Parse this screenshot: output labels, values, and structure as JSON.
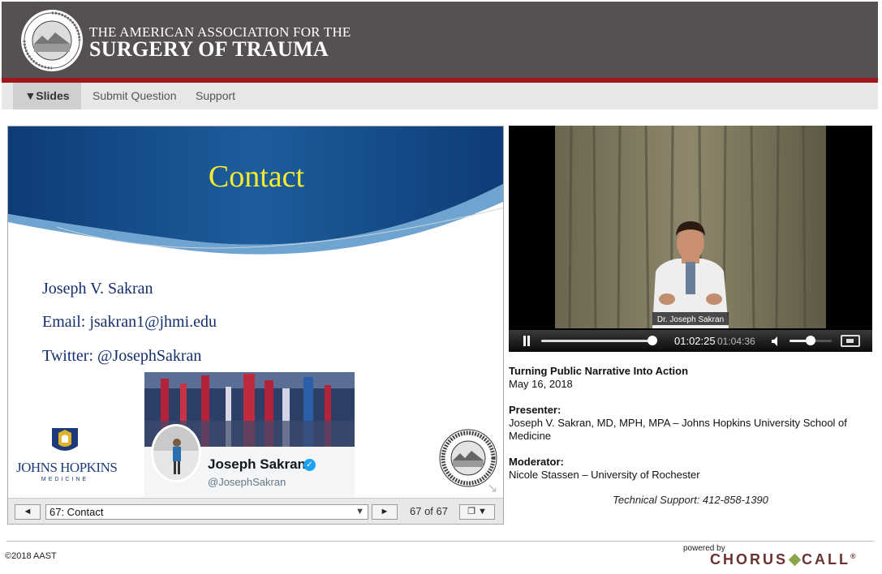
{
  "header": {
    "org_line1": "THE AMERICAN ASSOCIATION FOR THE",
    "org_line2": "SURGERY OF TRAUMA",
    "seal_icon": "aast-seal-icon",
    "bg_color": "#555152",
    "accent_color": "#a0161b"
  },
  "nav": {
    "slides": "▼Slides",
    "submit_question": "Submit Question",
    "support": "Support"
  },
  "slide": {
    "title": "Contact",
    "name": "Joseph V. Sakran",
    "email": "Email: jsakran1@jhmi.edu",
    "twitter": "Twitter: @JosephSakran",
    "jh_logo_text": "JOHNS HOPKINS",
    "jh_logo_sub": "MEDICINE",
    "twitter_card": {
      "name": "Joseph Sakran",
      "handle": "@JosephSakran",
      "verified_icon": "verified-badge-icon"
    }
  },
  "slide_controls": {
    "prev_label": "◄",
    "next_label": "►",
    "selected_slide": "67: Contact",
    "counter": "67 of 67",
    "layout_label": "❐ ▼"
  },
  "video": {
    "lower_third": "Dr. Joseph Sakran",
    "time_current": "01:02:25",
    "time_total": "01:04:36",
    "progress_fraction": 0.966,
    "volume_fraction": 0.5
  },
  "info": {
    "title": "Turning Public Narrative Into Action",
    "date": "May 16, 2018",
    "presenter_label": "Presenter:",
    "presenter": "Joseph V. Sakran, MD, MPH, MPA – Johns Hopkins University School of Medicine",
    "moderator_label": "Moderator:",
    "moderator": "Nicole Stassen – University of Rochester",
    "support": "Technical Support: 412-858-1390"
  },
  "footer": {
    "copyright": "©2018 AAST",
    "powered_by": "powered by",
    "brand_left": "CHORUS",
    "brand_right": "CALL",
    "brand_mark": "®"
  }
}
